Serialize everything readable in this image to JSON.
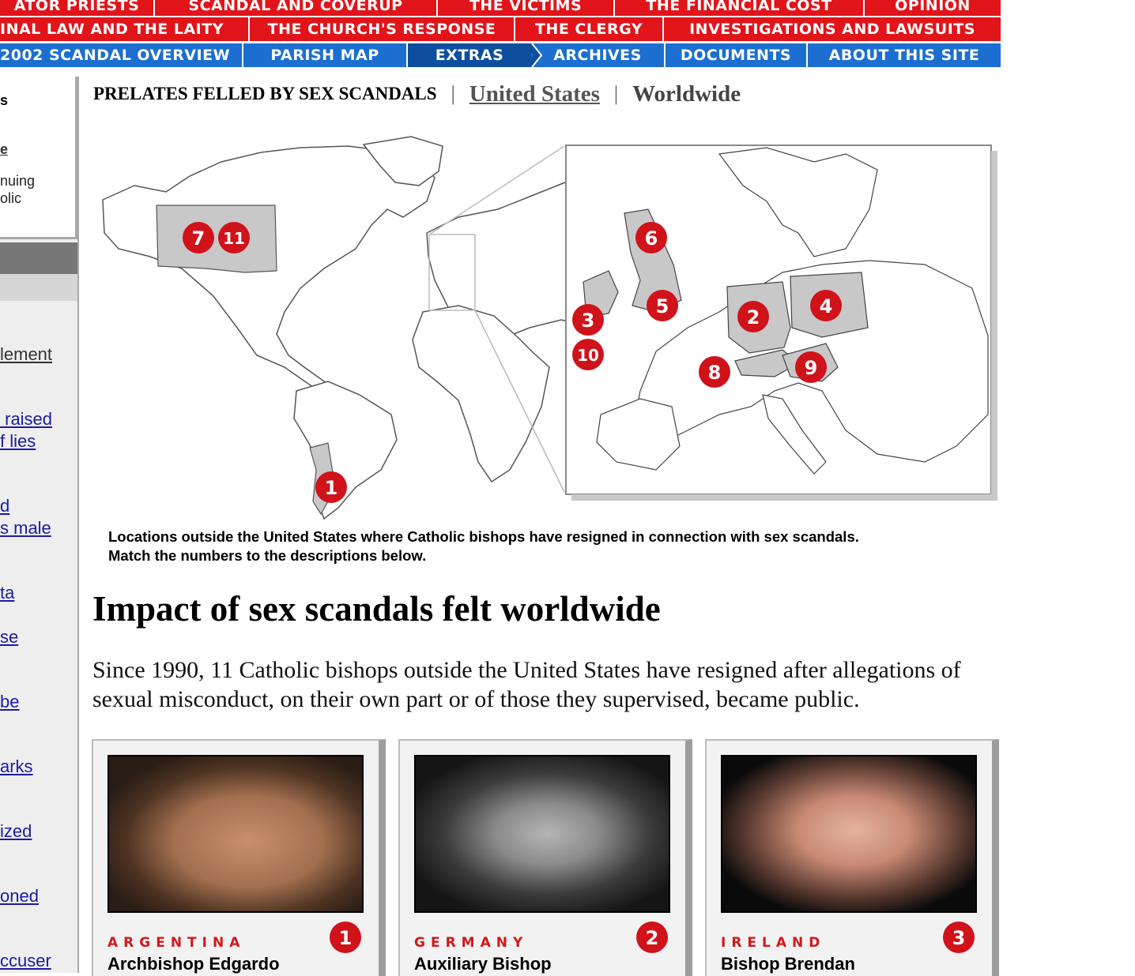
{
  "nav": {
    "row1": [
      "ATOR PRIESTS",
      "SCANDAL AND COVERUP",
      "THE VICTIMS",
      "THE FINANCIAL COST",
      "OPINION"
    ],
    "row2": [
      "INAL LAW AND THE LAITY",
      "THE CHURCH'S RESPONSE",
      "THE CLERGY",
      "INVESTIGATIONS AND LAWSUITS"
    ],
    "row3": [
      "2002 SCANDAL OVERVIEW",
      "PARISH MAP",
      "EXTRAS",
      "ARCHIVES",
      "DOCUMENTS",
      "ABOUT THIS SITE"
    ]
  },
  "sidebar": {
    "box_text_1": "s",
    "box_link": "e",
    "box_text_2": "nuing\nolic",
    "links": [
      "lement",
      " raised\nf lies",
      "d\ns male",
      "ta",
      "se",
      "be",
      "arks",
      "ized",
      "oned",
      "ccuser"
    ]
  },
  "header": {
    "title": "PRELATES FELLED BY SEX SCANDALS",
    "sep": "|",
    "us_link": "United States",
    "worldwide": "Worldwide"
  },
  "map": {
    "markers": [
      "1",
      "2",
      "3",
      "4",
      "5",
      "6",
      "7",
      "8",
      "9",
      "10",
      "11"
    ],
    "colors": {
      "marker": "#d0121b",
      "highlight": "#c8c8c8",
      "land": "#ffffff",
      "outline": "#555555"
    }
  },
  "caption": {
    "line1": "Locations outside the United States where Catholic bishops have resigned in connection with sex scandals.",
    "line2": "Match the numbers to the descriptions below."
  },
  "article": {
    "headline": "Impact of sex scandals felt worldwide",
    "lead": "Since 1990, 11 Catholic bishops outside the United States have resigned after allegations of sexual misconduct, on their own part or of those they supervised, became public."
  },
  "cards": [
    {
      "country": "ARGENTINA",
      "name": "Archbishop Edgardo",
      "num": "1"
    },
    {
      "country": "GERMANY",
      "name": "Auxiliary Bishop",
      "num": "2"
    },
    {
      "country": "IRELAND",
      "name": "Bishop Brendan",
      "num": "3"
    }
  ]
}
